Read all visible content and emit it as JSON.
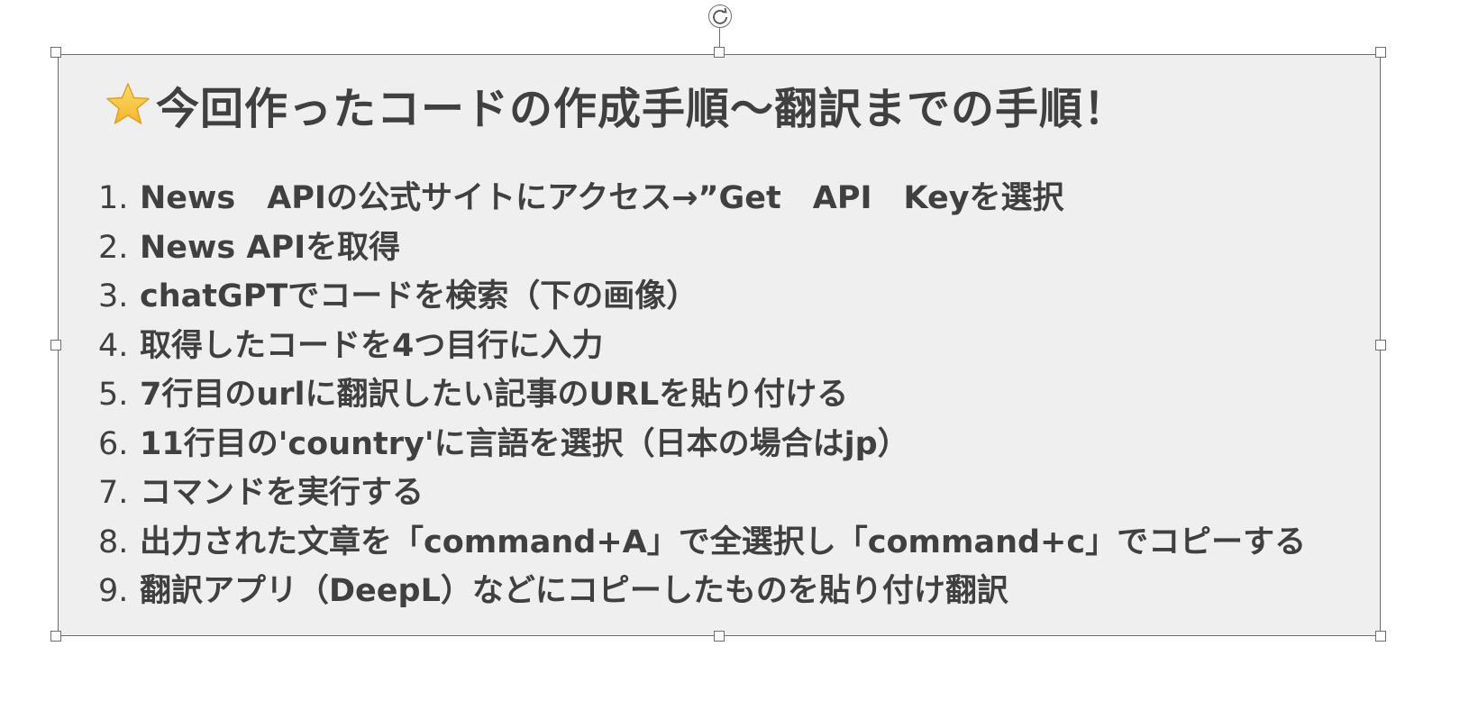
{
  "slide": {
    "title": "今回作ったコードの作成手順〜翻訳までの手順！",
    "title_icon": "star-icon",
    "accent_star_color": "#f6c343",
    "steps": [
      {
        "num": "1.",
        "text": "News　APIの公式サイトにアクセス→”Get　API　Keyを選択"
      },
      {
        "num": "2.",
        "text": "News APIを取得"
      },
      {
        "num": "3.",
        "text": "chatGPTでコードを検索（下の画像）"
      },
      {
        "num": "4.",
        "text": "取得したコードを4つ目行に入力"
      },
      {
        "num": "5.",
        "text": "7行目のurlに翻訳したい記事のURLを貼り付ける"
      },
      {
        "num": "6.",
        "text": "11行目の'country'に言語を選択（日本の場合はjp）"
      },
      {
        "num": "7.",
        "text": "コマンドを実行する"
      },
      {
        "num": "8.",
        "text": "出力された文章を「command+A」で全選択し「command+c」でコピーする"
      },
      {
        "num": "9.",
        "text": "翻訳アプリ（DeepL）などにコピーしたものを貼り付け翻訳"
      }
    ]
  },
  "selection": {
    "handle_icon": "resize-handle",
    "rotate_icon": "rotate-icon"
  }
}
